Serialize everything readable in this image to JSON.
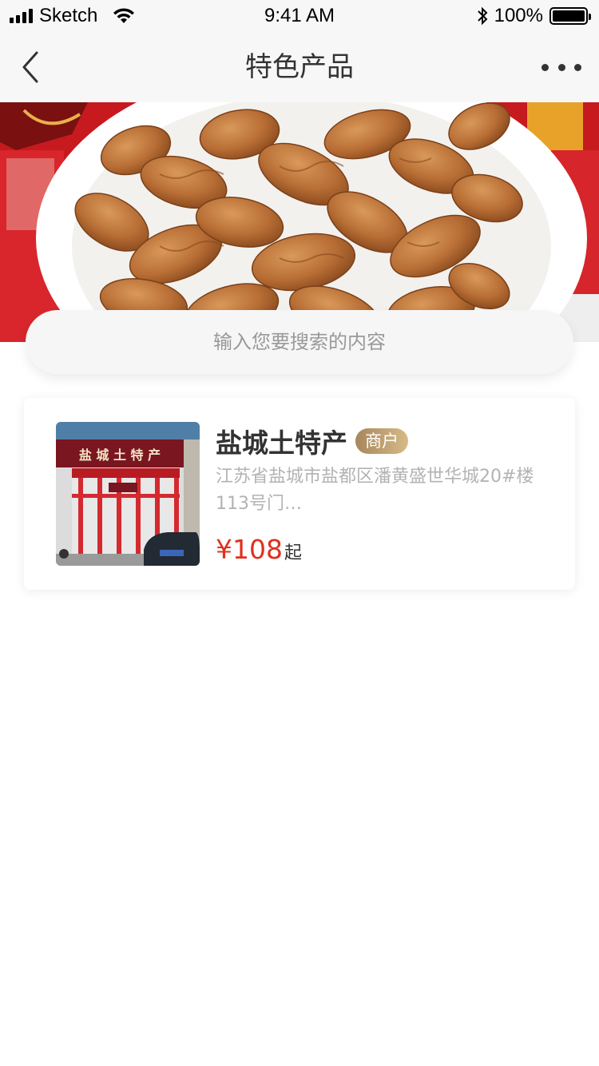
{
  "status_bar": {
    "carrier": "Sketch",
    "time": "9:41 AM",
    "battery": "100%",
    "battery_level": 1.0
  },
  "nav": {
    "title": "特色产品",
    "back_icon": "chevron-left-icon",
    "more_icon": "more-horizontal-icon"
  },
  "search": {
    "placeholder": "输入您要搜索的内容"
  },
  "shop": {
    "name": "盐城土特产",
    "badge": "商户",
    "address": "江苏省盐城市盐都区潘黄盛世华城20#楼113号门…",
    "price": "¥108",
    "price_suffix": "起",
    "sign_text": "盐 城 土 特 产"
  },
  "colors": {
    "accent_red": "#e0301e",
    "badge_gold": "#b8996a",
    "nav_bg": "#f7f7f7"
  }
}
